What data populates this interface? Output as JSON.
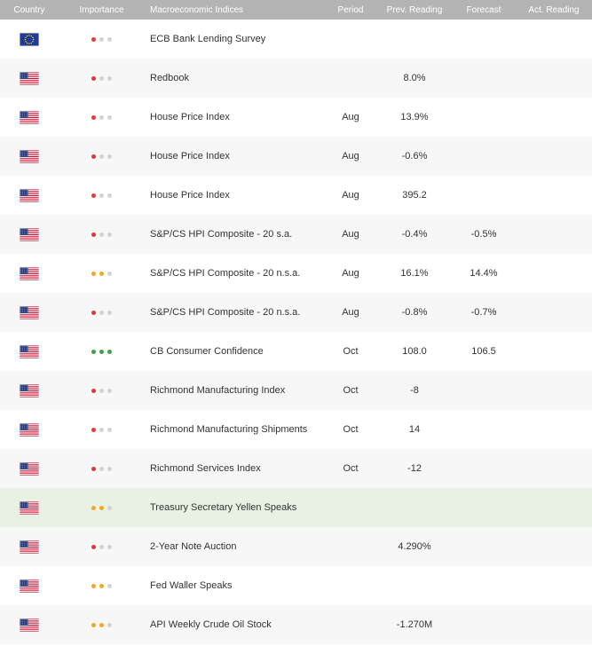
{
  "header": {
    "country": "Country",
    "importance": "Importance",
    "indices": "Macroeconomic Indices",
    "period": "Period",
    "prev": "Prev. Reading",
    "forecast": "Forecast",
    "actual": "Act. Reading"
  },
  "colors": {
    "header_bg": "#b4b4b4",
    "importance_1": "#e53935",
    "importance_2": "#f5a623",
    "importance_3": "#43a047",
    "importance_off": "#d3d3d3",
    "highlight_row": "#e8f1e4"
  },
  "rows": [
    {
      "flag": "eu-flag",
      "importance": 1,
      "name": "ECB Bank Lending Survey",
      "period": "",
      "prev": "",
      "forecast": "",
      "actual": "",
      "highlighted": false
    },
    {
      "flag": "us-flag",
      "importance": 1,
      "name": "Redbook",
      "period": "",
      "prev": "8.0%",
      "forecast": "",
      "actual": "",
      "highlighted": false
    },
    {
      "flag": "us-flag",
      "importance": 1,
      "name": "House Price Index",
      "period": "Aug",
      "prev": "13.9%",
      "forecast": "",
      "actual": "",
      "highlighted": false
    },
    {
      "flag": "us-flag",
      "importance": 1,
      "name": "House Price Index",
      "period": "Aug",
      "prev": "-0.6%",
      "forecast": "",
      "actual": "",
      "highlighted": false
    },
    {
      "flag": "us-flag",
      "importance": 1,
      "name": "House Price Index",
      "period": "Aug",
      "prev": "395.2",
      "forecast": "",
      "actual": "",
      "highlighted": false
    },
    {
      "flag": "us-flag",
      "importance": 1,
      "name": "S&P/CS HPI Composite - 20 s.a.",
      "period": "Aug",
      "prev": "-0.4%",
      "forecast": "-0.5%",
      "actual": "",
      "highlighted": false
    },
    {
      "flag": "us-flag",
      "importance": 2,
      "name": "S&P/CS HPI Composite - 20 n.s.a.",
      "period": "Aug",
      "prev": "16.1%",
      "forecast": "14.4%",
      "actual": "",
      "highlighted": false
    },
    {
      "flag": "us-flag",
      "importance": 1,
      "name": "S&P/CS HPI Composite - 20 n.s.a.",
      "period": "Aug",
      "prev": "-0.8%",
      "forecast": "-0.7%",
      "actual": "",
      "highlighted": false
    },
    {
      "flag": "us-flag",
      "importance": 3,
      "name": "CB Consumer Confidence",
      "period": "Oct",
      "prev": "108.0",
      "forecast": "106.5",
      "actual": "",
      "highlighted": false
    },
    {
      "flag": "us-flag",
      "importance": 1,
      "name": "Richmond Manufacturing Index",
      "period": "Oct",
      "prev": "-8",
      "forecast": "",
      "actual": "",
      "highlighted": false
    },
    {
      "flag": "us-flag",
      "importance": 1,
      "name": "Richmond Manufacturing Shipments",
      "period": "Oct",
      "prev": "14",
      "forecast": "",
      "actual": "",
      "highlighted": false
    },
    {
      "flag": "us-flag",
      "importance": 1,
      "name": "Richmond Services Index",
      "period": "Oct",
      "prev": "-12",
      "forecast": "",
      "actual": "",
      "highlighted": false
    },
    {
      "flag": "us-flag",
      "importance": 2,
      "name": "Treasury Secretary Yellen Speaks",
      "period": "",
      "prev": "",
      "forecast": "",
      "actual": "",
      "highlighted": true
    },
    {
      "flag": "us-flag",
      "importance": 1,
      "name": "2-Year Note Auction",
      "period": "",
      "prev": "4.290%",
      "forecast": "",
      "actual": "",
      "highlighted": false
    },
    {
      "flag": "us-flag",
      "importance": 2,
      "name": "Fed Waller Speaks",
      "period": "",
      "prev": "",
      "forecast": "",
      "actual": "",
      "highlighted": false
    },
    {
      "flag": "us-flag",
      "importance": 2,
      "name": "API Weekly Crude Oil Stock",
      "period": "",
      "prev": "-1.270M",
      "forecast": "",
      "actual": "",
      "highlighted": false
    }
  ]
}
